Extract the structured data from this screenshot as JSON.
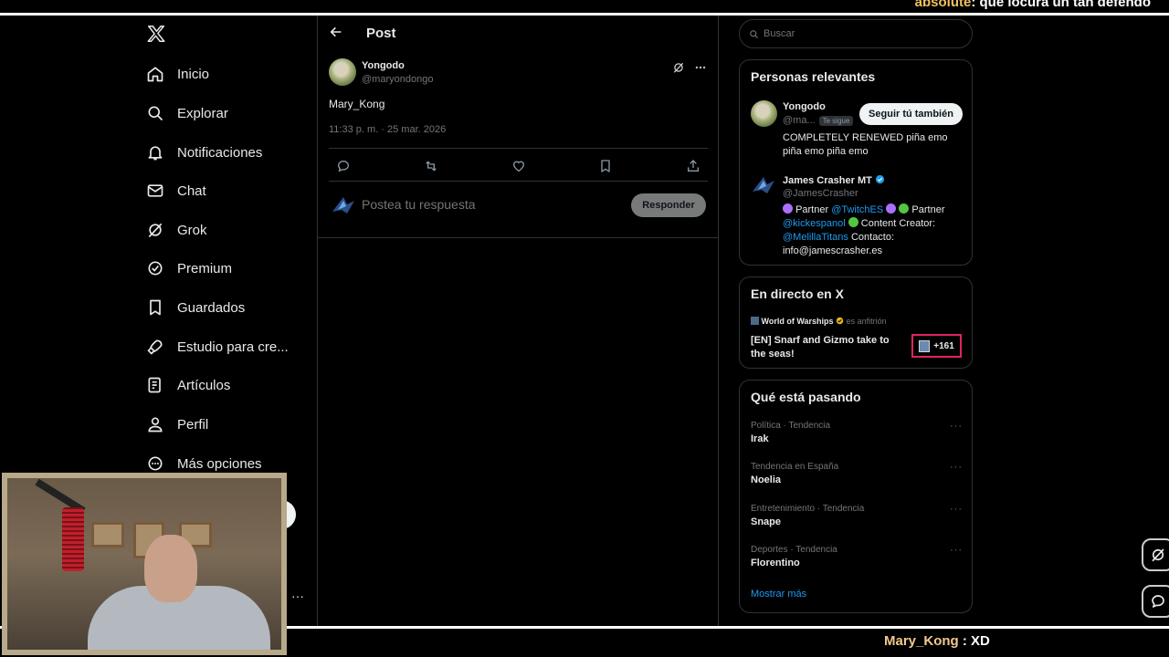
{
  "overlay": {
    "top_chat_user": "absolute",
    "top_chat_text": ": que locura un tan defendo",
    "bottom_chat_user": "Mary_Kong",
    "bottom_chat_text": " : XD"
  },
  "nav": {
    "items": [
      {
        "label": "Inicio",
        "icon": "home-icon"
      },
      {
        "label": "Explorar",
        "icon": "search-icon"
      },
      {
        "label": "Notificaciones",
        "icon": "bell-icon"
      },
      {
        "label": "Chat",
        "icon": "mail-icon"
      },
      {
        "label": "Grok",
        "icon": "grok-icon"
      },
      {
        "label": "Premium",
        "icon": "verified-icon"
      },
      {
        "label": "Guardados",
        "icon": "bookmark-icon"
      },
      {
        "label": "Estudio para cre...",
        "icon": "rocket-icon"
      },
      {
        "label": "Artículos",
        "icon": "article-icon"
      },
      {
        "label": "Perfil",
        "icon": "person-icon"
      },
      {
        "label": "Más opciones",
        "icon": "more-circle-icon"
      }
    ]
  },
  "post": {
    "header_title": "Post",
    "author_name": "Yongodo",
    "author_handle": "@maryondongo",
    "text": "Mary_Kong",
    "timestamp": "11:33 p. m. · 25 mar. 2026",
    "reply_placeholder": "Postea tu respuesta",
    "reply_button": "Responder"
  },
  "search": {
    "placeholder": "Buscar"
  },
  "relevant": {
    "title": "Personas relevantes",
    "people": [
      {
        "name": "Yongodo",
        "handle": "@ma...",
        "badge": "Te sigue",
        "follow_label": "Seguir tú también",
        "bio": "COMPLETELY RENEWED piña emo piña emo piña emo"
      },
      {
        "name": "James Crasher MT",
        "handle": "@JamesCrasher",
        "bio_1": "Partner ",
        "bio_link_1": "@TwitchES",
        "bio_2": "Partner",
        "bio_link_2": "@kickespanol",
        "bio_3": "Content Creator:",
        "bio_link_3": "@MelillaTitans",
        "bio_4": "Contacto:",
        "bio_5": "info@jamescrasher.es"
      }
    ]
  },
  "live": {
    "title": "En directo en X",
    "host": "World of Warships",
    "host_role": "es anfitrión",
    "stream_title": "[EN] Snarf and Gizmo take to the seas!",
    "count": "+161"
  },
  "trends": {
    "title": "Qué está pasando",
    "items": [
      {
        "category": "Política · Tendencia",
        "name": "Irak"
      },
      {
        "category": "Tendencia en España",
        "name": "Noelia"
      },
      {
        "category": "Entretenimiento · Tendencia",
        "name": "Snape"
      },
      {
        "category": "Deportes · Tendencia",
        "name": "Florentino"
      }
    ],
    "more_label": "···",
    "show_more": "Mostrar más"
  },
  "colors": {
    "accent": "#1d9bf0",
    "background": "#000000",
    "border": "#2f3336",
    "muted": "#71767b",
    "live_border": "#e0245e"
  }
}
